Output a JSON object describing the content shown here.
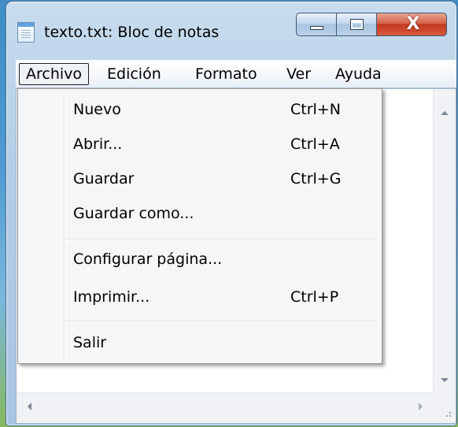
{
  "window": {
    "title": "texto.txt: Bloc de notas",
    "close_glyph": "X"
  },
  "menubar": {
    "items": [
      {
        "label": "Archivo",
        "active": true
      },
      {
        "label": "Edición"
      },
      {
        "label": "Formato"
      },
      {
        "label": "Ver"
      },
      {
        "label": "Ayuda"
      }
    ]
  },
  "file_menu": {
    "items": [
      {
        "label": "Nuevo",
        "shortcut": "Ctrl+N"
      },
      {
        "label": "Abrir...",
        "shortcut": "Ctrl+A"
      },
      {
        "label": "Guardar",
        "shortcut": "Ctrl+G"
      },
      {
        "label": "Guardar como...",
        "shortcut": ""
      },
      {
        "label": "Configurar página...",
        "shortcut": ""
      },
      {
        "label": "Imprimir...",
        "shortcut": "Ctrl+P"
      },
      {
        "label": "Salir",
        "shortcut": ""
      }
    ]
  },
  "icons": {
    "app": "notepad-icon",
    "minimize": "minimize-icon",
    "maximize": "maximize-icon",
    "close": "close-icon"
  },
  "colors": {
    "close_button": "#c2381f",
    "menu_background": "#f5f6f7",
    "titlebar": "#b2cde6"
  }
}
